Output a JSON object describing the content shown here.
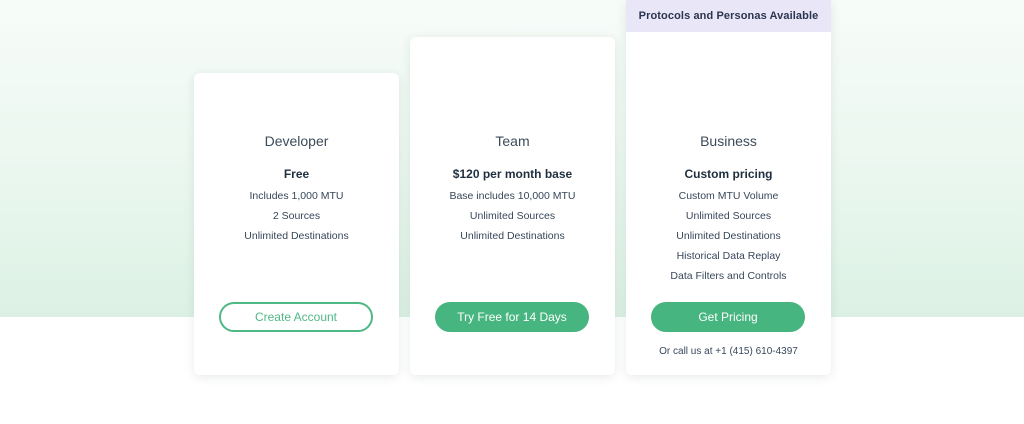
{
  "plans": [
    {
      "name": "Developer",
      "price": "Free",
      "features": [
        "Includes 1,000 MTU",
        "2 Sources",
        "Unlimited Destinations"
      ],
      "cta": "Create Account"
    },
    {
      "name": "Team",
      "price": "$120 per month base",
      "features": [
        "Base includes 10,000 MTU",
        "Unlimited Sources",
        "Unlimited Destinations"
      ],
      "cta": "Try Free for 14 Days"
    },
    {
      "ribbon": "Protocols and Personas Available",
      "name": "Business",
      "price": "Custom pricing",
      "features": [
        "Custom MTU Volume",
        "Unlimited Sources",
        "Unlimited Destinations",
        "Historical Data Replay",
        "Data Filters and Controls"
      ],
      "cta": "Get Pricing",
      "call_note": "Or call us at +1 (415) 610-4397"
    }
  ],
  "colors": {
    "accent": "#47b57f",
    "ribbon_bg": "#e8e6f7",
    "text": "#2d3f50"
  }
}
